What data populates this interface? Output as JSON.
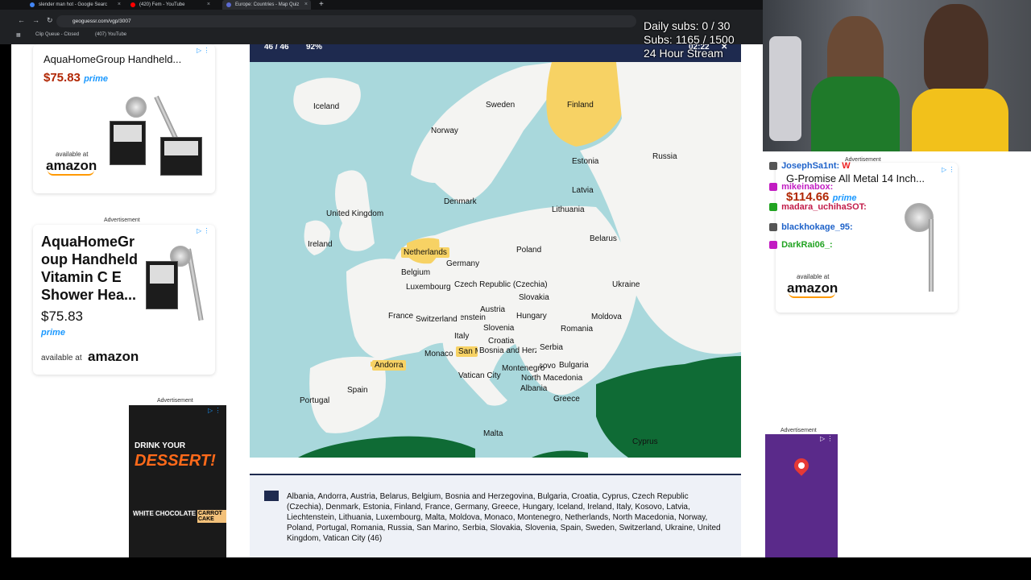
{
  "browser": {
    "tabs": [
      {
        "label": "slender man hot - Google Searc"
      },
      {
        "label": "(420) Fem - YouTube"
      },
      {
        "label": "Europe: Countries - Map Quiz"
      }
    ],
    "new_tab": "+",
    "url": "geoguessr.com/vgp/3007",
    "bookmarks": [
      {
        "label": "Clip Queue - Closed"
      },
      {
        "label": "(407) YouTube"
      }
    ]
  },
  "overlay": {
    "daily_subs": "Daily subs: 0 / 30",
    "subs": "Subs: 1165 / 1500",
    "stream": "24 Hour Stream"
  },
  "ads": {
    "ad1": {
      "title": "AquaHomeGroup Handheld...",
      "price": "$75.83",
      "prime": "prime",
      "available": "available at",
      "brand": "amazon"
    },
    "ad2": {
      "label": "Advertisement",
      "title": "AquaHomeGr oup Handheld Vitamin C E Shower Hea...",
      "price": "$75.83",
      "prime": "prime",
      "available": "available at",
      "brand": "amazon"
    },
    "ad3": {
      "label": "Advertisement",
      "line1": "DRINK YOUR",
      "line2": "DESSERT!",
      "badge1": "WHITE CHOCOLATE",
      "badge2": "CARROT CAKE"
    },
    "ad4": {
      "label": "Advertisement",
      "title": "G-Promise All Metal 14 Inch...",
      "price": "$114.66",
      "prime": "prime",
      "available": "available at",
      "brand": "amazon"
    },
    "ad5": {
      "label": "Advertisement"
    }
  },
  "quiz": {
    "score": "46 / 46",
    "percent": "92%",
    "timer": "02:22",
    "countries": [
      "Iceland",
      "Sweden",
      "Finland",
      "Norway",
      "Russia",
      "Estonia",
      "Latvia",
      "Denmark",
      "Lithuania",
      "United Kingdom",
      "Ireland",
      "Netherlands",
      "Poland",
      "Belarus",
      "Germany",
      "Belgium",
      "Luxembourg",
      "Czech Republic (Czechia)",
      "Ukraine",
      "Slovakia",
      "Austria",
      "Liechtenstein",
      "France",
      "Switzerland",
      "Hungary",
      "Moldova",
      "Slovenia",
      "Romania",
      "Italy",
      "Croatia",
      "Serbia",
      "Monaco",
      "San Marino",
      "Bosnia and Herzegovina",
      "Andorra",
      "Montenegro",
      "Kosovo",
      "Bulgaria",
      "Vatican City",
      "North Macedonia",
      "Albania",
      "Spain",
      "Portugal",
      "Greece",
      "Malta",
      "Cyprus"
    ],
    "answer_list": "Albania, Andorra, Austria, Belarus, Belgium, Bosnia and Herzegovina, Bulgaria, Croatia, Cyprus, Czech Republic (Czechia), Denmark, Estonia, Finland, France, Germany, Greece, Hungary, Iceland, Ireland, Italy, Kosovo, Latvia, Liechtenstein, Lithuania, Luxembourg, Malta, Moldova, Monaco, Montenegro, Netherlands, North Macedonia, Norway, Poland, Portugal, Romania, Russia, San Marino, Serbia, Slovakia, Slovenia, Spain, Sweden, Switzerland, Ukraine, United Kingdom, Vatican City (46)"
  },
  "chat": {
    "messages": [
      {
        "user": "JosephSa1nt:",
        "text": "W",
        "color": "#1e62c9"
      },
      {
        "user": "mikeinabox:",
        "text": "",
        "color": "#c21cc2"
      },
      {
        "user": "madara_uchihaSOT:",
        "text": "",
        "color": "#c21c4a"
      },
      {
        "user": "blackhokage_95:",
        "text": "",
        "color": "#1e62c9"
      },
      {
        "user": "DarkRai06_:",
        "text": "",
        "color": "#21a321"
      }
    ]
  },
  "colors": {
    "land": "#f4f4f2",
    "sea": "#a9d8dc",
    "nonquiz": "#0f6b35",
    "highlight": "#f7d264",
    "quizbar": "#1e2a4f"
  }
}
